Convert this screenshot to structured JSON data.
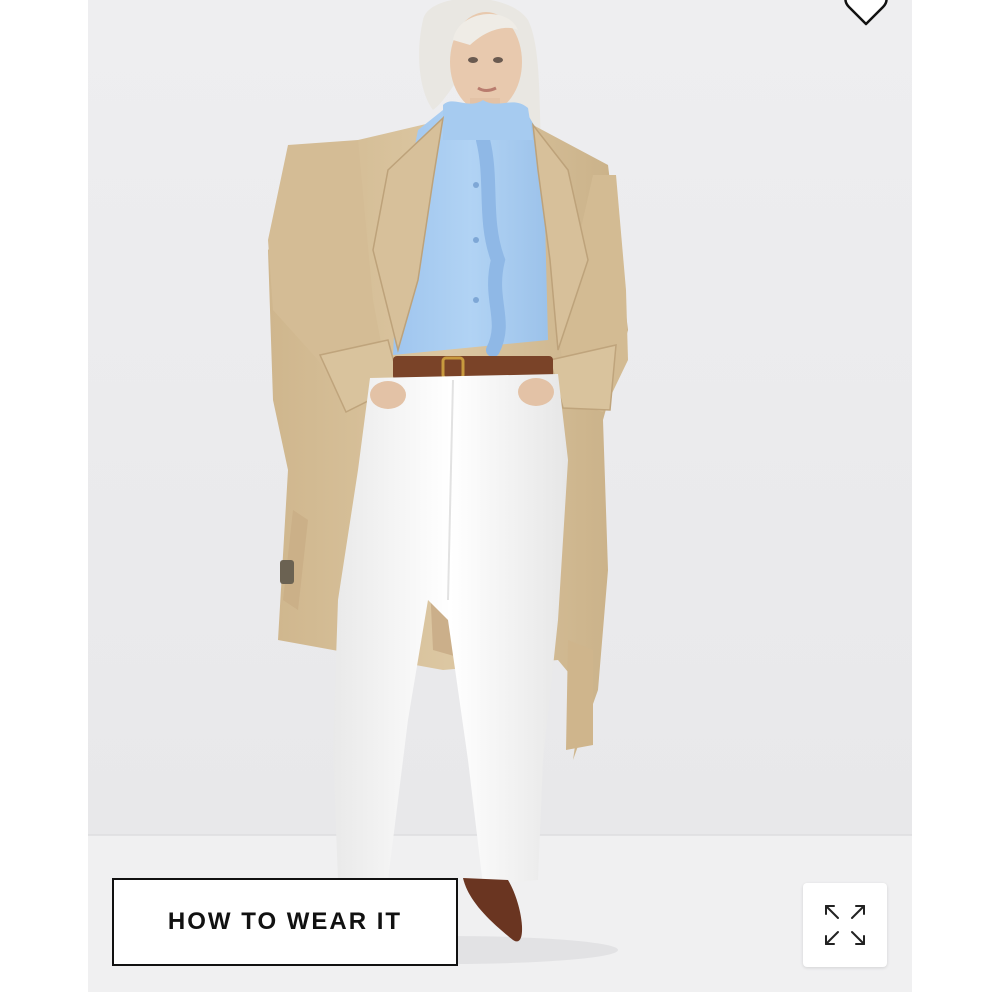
{
  "gallery": {
    "product_image": {
      "icon": "product-photo",
      "description_colors": {
        "backdrop": "#ececed",
        "floor": "#f1f1f2",
        "coat": "#d8c29c",
        "shirt": "#a9cdf1",
        "jeans": "#fafafa",
        "belt": "#7a4328",
        "shoes": "#6a3521"
      }
    },
    "wishlist_icon": "heart-outline-icon",
    "how_to_wear_label": "HOW TO WEAR IT",
    "expand_icon": "expand-arrows-icon"
  },
  "theme": {
    "accent": "#111111",
    "button_bg": "#ffffff"
  }
}
